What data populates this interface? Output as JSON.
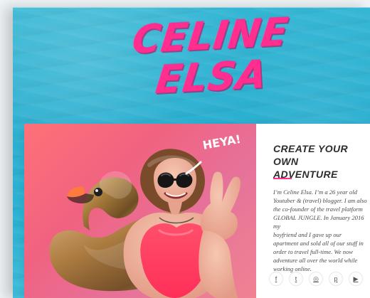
{
  "header": {
    "logo_line1": "CELINE",
    "logo_line2": "ELSA",
    "logo_color": "#FF2E8F"
  },
  "hero_photo": {
    "callout_text": "HEYA!",
    "background_colors": [
      "#FF6A70",
      "#E56B95"
    ],
    "alt": ""
  },
  "intro": {
    "headline": "CREATE YOUR OWN\nADVENTURE",
    "accent_color": "#FF2E8F",
    "bio": "I’m Celine Elsa. I’m a 26 year old\nYoutuber & (travel) blogger. I am also\nthe co-founder of the travel platform\nGLOBAL JUNGLE. In January 2016 my\nboyfriend and I gave up our\napartment and sold all of our stuff in\norder to travel full-time. We now\nadventure all over the world while\nworking online."
  },
  "social": {
    "items": [
      {
        "id": "facebook",
        "icon": "facebook-icon",
        "glyph": "f"
      },
      {
        "id": "twitter",
        "icon": "twitter-icon",
        "glyph": "t"
      },
      {
        "id": "instagram",
        "icon": "instagram-icon",
        "glyph": "◎"
      },
      {
        "id": "pinterest",
        "icon": "pinterest-icon",
        "glyph": "p"
      },
      {
        "id": "youtube",
        "icon": "youtube-icon",
        "glyph": "▶"
      }
    ]
  }
}
